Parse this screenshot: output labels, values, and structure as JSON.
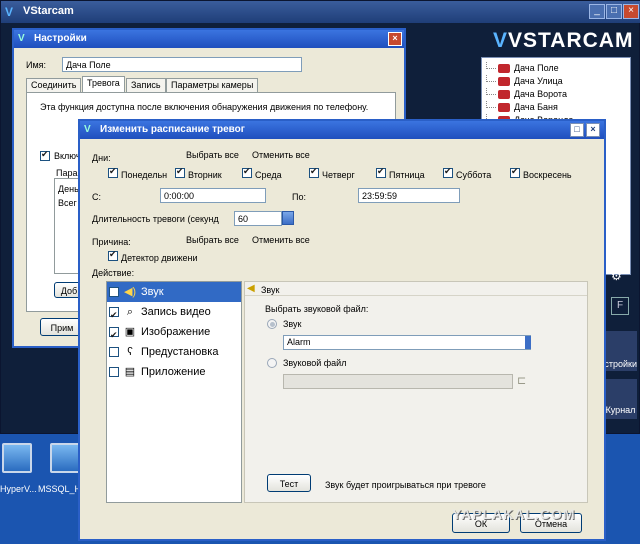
{
  "main": {
    "title": "VStarcam",
    "logo": "VSTARCAM",
    "devices": [
      "Дача Поле",
      "Дача Улица",
      "Дача Ворота",
      "Дача Баня",
      "Дача Веранда"
    ],
    "side_settings": "Настройки",
    "side_log": "Журнал"
  },
  "settings": {
    "title": "Настройки",
    "name_label": "Имя:",
    "name_value": "Дача Поле",
    "tabs": [
      "Соединить",
      "Тревога",
      "Запись",
      "Параметры камеры"
    ],
    "info_text": "Эта функция доступна после включения обнаружения движения по телефону.",
    "enable_label": "Включ",
    "param_label": "Парам",
    "col_label": "День",
    "row_label": "Всег",
    "add_button": "Доб",
    "apply_button": "Прим"
  },
  "dialog": {
    "title": "Изменить расписание тревог",
    "days_label": "Дни:",
    "select_all": "Выбрать все",
    "cancel_all": "Отменить все",
    "days": [
      {
        "label": "Понедельн",
        "checked": true
      },
      {
        "label": "Вторник",
        "checked": true
      },
      {
        "label": "Среда",
        "checked": true
      },
      {
        "label": "Четверг",
        "checked": true
      },
      {
        "label": "Пятница",
        "checked": true
      },
      {
        "label": "Суббота",
        "checked": true
      },
      {
        "label": "Воскресень",
        "checked": true
      }
    ],
    "from_label": "С:",
    "from_value": "0:00:00",
    "to_label": "По:",
    "to_value": "23:59:59",
    "duration_label": "Длительность тревоги (секунд",
    "duration_value": "60",
    "reason_label": "Причина:",
    "reason_select_all": "Выбрать все",
    "reason_cancel_all": "Отменить все",
    "motion_label": "Детектор движени",
    "action_label": "Действие:",
    "actions": [
      {
        "label": "Звук",
        "checked": false,
        "icon": "speaker-icon"
      },
      {
        "label": "Запись видео",
        "checked": true,
        "icon": "camera-icon"
      },
      {
        "label": "Изображение",
        "checked": true,
        "icon": "image-icon"
      },
      {
        "label": "Предустановка",
        "checked": false,
        "icon": "preset-icon"
      },
      {
        "label": "Приложение",
        "checked": false,
        "icon": "app-icon"
      }
    ],
    "sound_header": "Звук",
    "choose_file": "Выбрать звуковой файл:",
    "sound_radio": "Звук",
    "sound_value": "Alarm",
    "file_radio": "Звуковой файл",
    "test_button": "Тест",
    "test_hint": "Звук будет проигрываться при тревоге",
    "ok_button": "ОК",
    "cancel_button": "Отмена"
  },
  "desktop": {
    "icon1_label": "HyperV...",
    "icon2_label": "MSSQL_H"
  },
  "watermark": "YAPLAKAL.COM"
}
